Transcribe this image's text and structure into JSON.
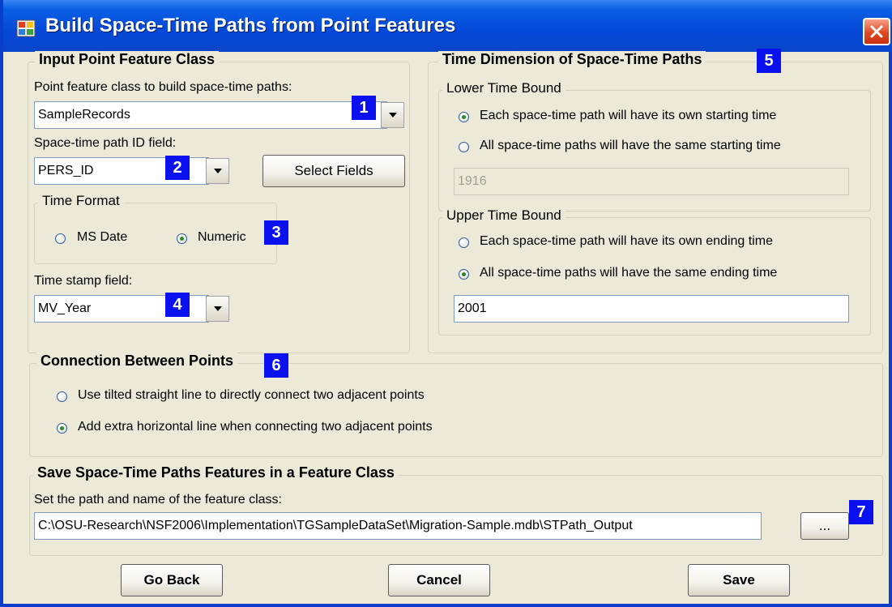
{
  "window": {
    "title": "Build Space-Time Paths from Point Features"
  },
  "input_group": {
    "legend": "Input Point Feature Class",
    "point_class_label": "Point feature class to build space-time paths:",
    "point_class_value": "SampleRecords",
    "path_id_label": "Space-time path ID field:",
    "path_id_value": "PERS_ID",
    "select_fields_button": "Select Fields",
    "time_format": {
      "legend": "Time Format",
      "ms_date": "MS Date",
      "numeric": "Numeric",
      "selected": "Numeric"
    },
    "timestamp_label": "Time stamp field:",
    "timestamp_value": "MV_Year"
  },
  "time_dimension": {
    "legend": "Time Dimension of Space-Time Paths",
    "lower": {
      "legend": "Lower Time Bound",
      "own_start": "Each space-time path will have its own starting time",
      "same_start": "All space-time paths will have the same starting time",
      "selected": "own_start",
      "value": "1916"
    },
    "upper": {
      "legend": "Upper Time Bound",
      "own_end": "Each space-time path will have its own ending time",
      "same_end": "All space-time paths will have the same ending time",
      "selected": "same_end",
      "value": "2001"
    }
  },
  "connection": {
    "legend": "Connection Between Points",
    "tilted": "Use tilted straight line to directly connect two adjacent points",
    "horizontal": "Add extra horizontal line when connecting two adjacent points",
    "selected": "horizontal"
  },
  "save_group": {
    "legend": "Save Space-Time Paths Features in a Feature Class",
    "path_label": "Set the path and name of the feature class:",
    "path_value": "C:\\OSU-Research\\NSF2006\\Implementation\\TGSampleDataSet\\Migration-Sample.mdb\\STPath_Output",
    "browse_button": "..."
  },
  "buttons": {
    "go_back": "Go Back",
    "cancel": "Cancel",
    "save": "Save"
  },
  "badges": [
    "1",
    "2",
    "3",
    "4",
    "5",
    "6",
    "7"
  ],
  "colors": {
    "titlebar": "#0548d8",
    "dialog_bg": "#ece9d8",
    "badge": "#0a10f0",
    "close": "#e04a22"
  },
  "icons": {
    "app": "app-icon",
    "close": "close-icon",
    "dropdown": "chevron-down-icon"
  }
}
